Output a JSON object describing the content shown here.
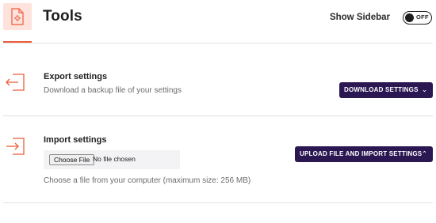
{
  "header": {
    "title": "Tools",
    "sidebar_toggle_label": "Show Sidebar",
    "sidebar_toggle_state": "OFF"
  },
  "export": {
    "title": "Export settings",
    "description": "Download a backup file of your settings",
    "button_label": "DOWNLOAD SETTINGS",
    "button_icon": "chevron-down-icon"
  },
  "import": {
    "title": "Import settings",
    "choose_file_label": "Choose File",
    "file_status": "No file chosen",
    "hint": "Choose a file from your computer (maximum size: 256 MB)",
    "button_label": "UPLOAD FILE AND IMPORT SETTINGS",
    "button_icon": "chevron-up-icon"
  },
  "colors": {
    "accent": "#ec5d3c",
    "accent_tint": "#fde3dc",
    "button_bg": "#2b1852",
    "divider": "#e3e3e3"
  }
}
